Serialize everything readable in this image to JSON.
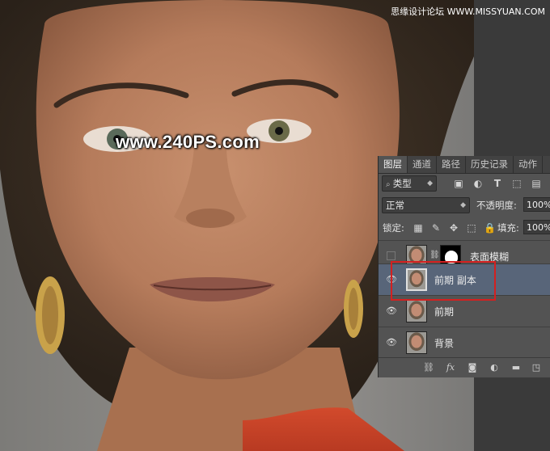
{
  "watermark_top": "思缘设计论坛 WWW.MISSYUAN.COM",
  "watermark_center": "www.240PS.com",
  "panel": {
    "tabs": [
      "图层",
      "通道",
      "路径",
      "历史记录",
      "动作"
    ],
    "active_tab": "图层",
    "filter_kind": "类型",
    "blend_mode": "正常",
    "opacity_label": "不透明度:",
    "opacity_value": "100%",
    "lock_label": "锁定:",
    "fill_label": "填充:",
    "fill_value": "100%",
    "layers": [
      {
        "name": "表面模糊",
        "visible": false,
        "has_mask": true,
        "selected": false
      },
      {
        "name": "前期 副本",
        "visible": true,
        "has_mask": false,
        "selected": true
      },
      {
        "name": "前期",
        "visible": true,
        "has_mask": false,
        "selected": false
      },
      {
        "name": "背景",
        "visible": true,
        "has_mask": false,
        "selected": false
      }
    ],
    "bottom_fx": "fx"
  },
  "colors": {
    "panel_bg": "#535353",
    "selected_layer": "#586579",
    "highlight_box": "#d42020"
  }
}
